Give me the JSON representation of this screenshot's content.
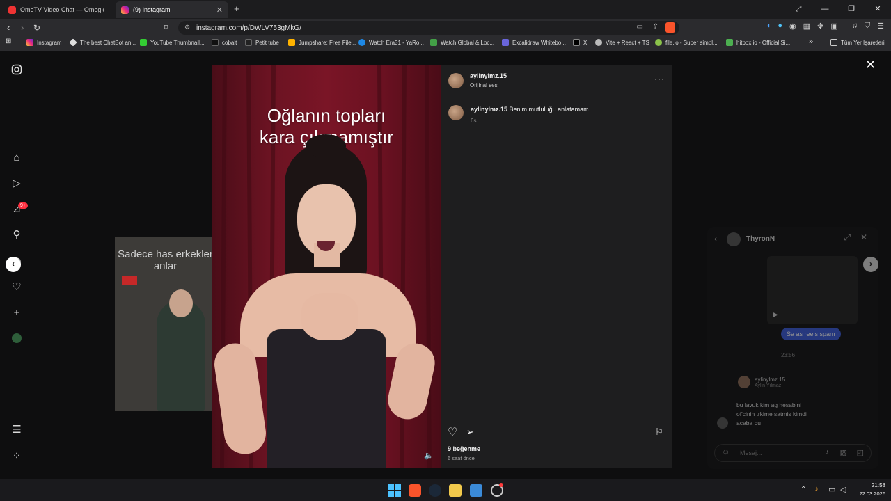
{
  "tabs": [
    {
      "title": "OmeTV Video Chat — Omegle R",
      "active": false
    },
    {
      "title": "(9) Instagram",
      "active": true
    }
  ],
  "url": "instagram.com/p/DWLV753gMkG/",
  "bookmarks": [
    "Instagram",
    "The best ChatBot an...",
    "YouTube Thumbnail...",
    "cobalt",
    "Petit tube",
    "Jumpshare: Free File...",
    "Watch Era31 - YaRo...",
    "Watch Global & Loc...",
    "Excalidraw Whitebo...",
    "X",
    "Vite + React + TS",
    "file.io - Super simpl...",
    "hitbox.io - Official Si..."
  ],
  "bookmarks_overflow": "»",
  "all_bookmarks": "Tüm Yer İşaretleri",
  "sidebar": {
    "notifications_badge": "9+"
  },
  "background_post": {
    "caption": "Sadece has erkekler anlar"
  },
  "post": {
    "video_caption": "Oğlanın topları kara çıkmamıştır",
    "author": "aylinylmz.15",
    "audio": "Orijinal ses",
    "comment_author": "aylinylmz.15",
    "comment_text": "Benim mutluluğu anlatamam",
    "comment_time": "6s",
    "likes": "9 beğenme",
    "posted_ago": "6 saat önce"
  },
  "dm": {
    "contact": "ThyronN",
    "sent_message": "Sa as reels spam",
    "time": "23:56",
    "shared_user": "aylinylmz.15",
    "shared_name": "Aylin Yılmaz",
    "received_message": "bu lavuk kim ag hesabini of'cinin trkime satmis kimdi acaba bu",
    "input_placeholder": "Mesaj..."
  },
  "clock": {
    "time": "21:58",
    "date": "22.03.2026"
  },
  "colors": {
    "accent": "#0095f6",
    "curtain": "#7a1526",
    "brave": "#fb542b"
  }
}
